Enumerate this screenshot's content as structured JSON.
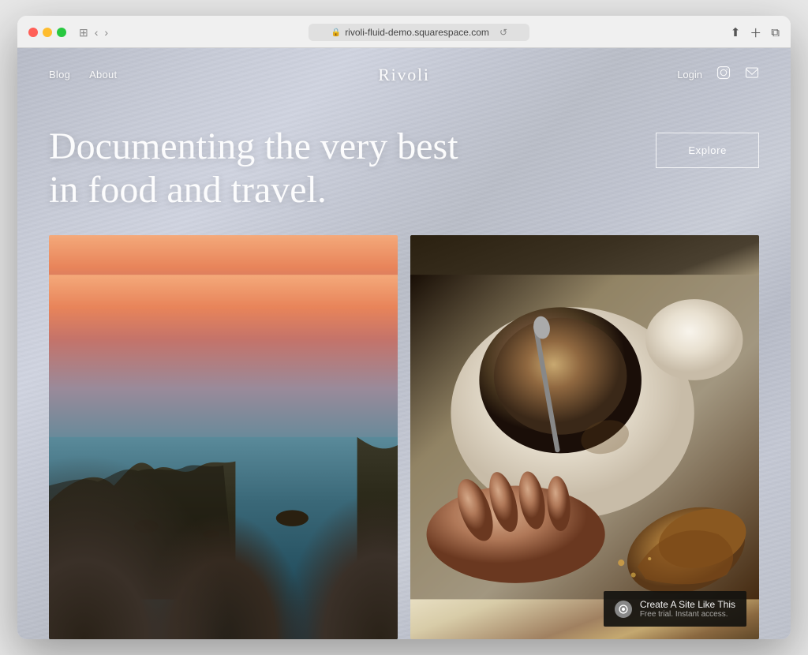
{
  "browser": {
    "url": "rivoli-fluid-demo.squarespace.com",
    "reload_icon": "↺"
  },
  "nav": {
    "blog_label": "Blog",
    "about_label": "About",
    "brand": "Rivoli",
    "login_label": "Login"
  },
  "hero": {
    "headline": "Documenting the very best in food and travel.",
    "explore_button": "Explore"
  },
  "images": {
    "coastal_alt": "Coastal landscape at sunset",
    "coffee_alt": "Coffee cup with croissant"
  },
  "squarespace": {
    "logo_text": "✦",
    "title": "Create A Site Like This",
    "subtitle": "Free trial. Instant access."
  }
}
